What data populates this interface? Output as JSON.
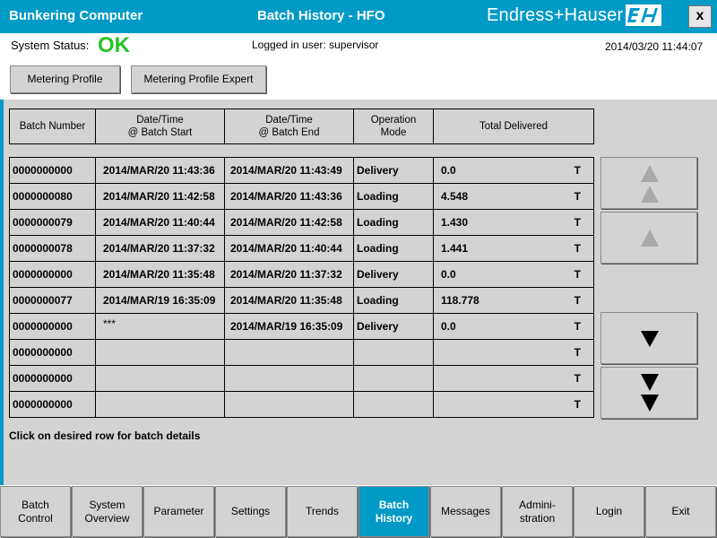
{
  "window": {
    "app_title": "Bunkering Computer",
    "screen_title": "Batch History - HFO",
    "brand": "Endress+Hauser",
    "logo_text": "EH",
    "close_label": "x"
  },
  "status": {
    "label": "System Status:",
    "value": "OK",
    "value_color": "#26c326",
    "user": "Logged in user: supervisor",
    "datetime": "2014/03/20 11:44:07"
  },
  "toolbar": {
    "metering_profile": "Metering Profile",
    "metering_profile_expert": "Metering Profile Expert"
  },
  "table": {
    "headers": {
      "batch_number": "Batch Number",
      "start": "Date/Time\n@ Batch Start",
      "end": "Date/Time\n@ Batch End",
      "mode": "Operation\nMode",
      "total": "Total Delivered"
    },
    "rows": [
      {
        "number": "0000000000",
        "start": "2014/MAR/20 11:43:36",
        "end": "2014/MAR/20 11:43:49",
        "mode": "Delivery",
        "total": "0.0",
        "unit": "T"
      },
      {
        "number": "0000000080",
        "start": "2014/MAR/20 11:42:58",
        "end": "2014/MAR/20 11:43:36",
        "mode": "Loading",
        "total": "4.548",
        "unit": "T"
      },
      {
        "number": "0000000079",
        "start": "2014/MAR/20 11:40:44",
        "end": "2014/MAR/20 11:42:58",
        "mode": "Loading",
        "total": "1.430",
        "unit": "T"
      },
      {
        "number": "0000000078",
        "start": "2014/MAR/20 11:37:32",
        "end": "2014/MAR/20 11:40:44",
        "mode": "Loading",
        "total": "1.441",
        "unit": "T"
      },
      {
        "number": "0000000000",
        "start": "2014/MAR/20 11:35:48",
        "end": "2014/MAR/20 11:37:32",
        "mode": "Delivery",
        "total": "0.0",
        "unit": "T"
      },
      {
        "number": "0000000077",
        "start": "2014/MAR/19 16:35:09",
        "end": "2014/MAR/20 11:35:48",
        "mode": "Loading",
        "total": "118.778",
        "unit": "T"
      },
      {
        "number": "0000000000",
        "start": "***",
        "end": "2014/MAR/19 16:35:09",
        "mode": "Delivery",
        "total": "0.0",
        "unit": "T"
      },
      {
        "number": "0000000000",
        "start": "",
        "end": "",
        "mode": "",
        "total": "",
        "unit": "T"
      },
      {
        "number": "0000000000",
        "start": "",
        "end": "",
        "mode": "",
        "total": "",
        "unit": "T"
      },
      {
        "number": "0000000000",
        "start": "",
        "end": "",
        "mode": "",
        "total": "",
        "unit": "T"
      }
    ]
  },
  "hint": "Click on desired row for batch details",
  "scroll_buttons": {
    "page_up_icon": "double-up-triangle-icon",
    "line_up_icon": "up-triangle-icon",
    "line_down_icon": "down-triangle-icon",
    "page_down_icon": "double-down-triangle-icon"
  },
  "nav": [
    {
      "label": "Batch\nControl",
      "active": false
    },
    {
      "label": "System\nOverview",
      "active": false
    },
    {
      "label": "Parameter",
      "active": false
    },
    {
      "label": "Settings",
      "active": false
    },
    {
      "label": "Trends",
      "active": false
    },
    {
      "label": "Batch\nHistory",
      "active": true
    },
    {
      "label": "Messages",
      "active": false
    },
    {
      "label": "Admini-\nstration",
      "active": false
    },
    {
      "label": "Login",
      "active": false
    },
    {
      "label": "Exit",
      "active": false
    }
  ],
  "colors": {
    "accent": "#009ac6",
    "panel": "#d3d3d3"
  }
}
